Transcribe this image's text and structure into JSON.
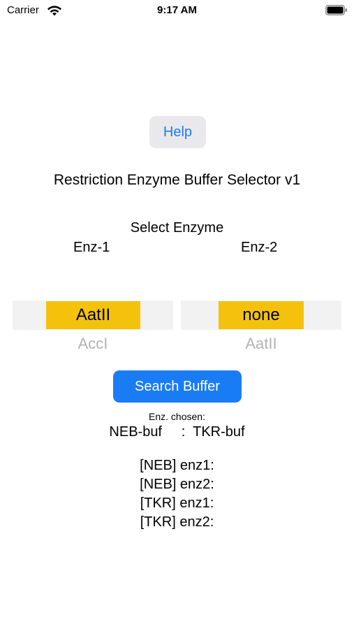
{
  "status_bar": {
    "carrier": "Carrier",
    "time": "9:17 AM",
    "wifi_icon": "wifi-icon",
    "battery_icon": "battery-icon"
  },
  "help": {
    "label": "Help"
  },
  "app_title": "Restriction Enzyme Buffer Selector v1",
  "select_label": "Select Enzyme",
  "enz1": {
    "label": "Enz-1",
    "selected": "AatII",
    "next": "AccI"
  },
  "enz2": {
    "label": "Enz-2",
    "selected": "none",
    "next": "AatII"
  },
  "search": {
    "label": "Search Buffer"
  },
  "enz_chosen_label": "Enz. chosen:",
  "buffers": {
    "neb": "NEB-buf",
    "sep": ":",
    "tkr": "TKR-buf"
  },
  "results": [
    "[NEB] enz1:",
    "[NEB] enz2:",
    "[TKR] enz1:",
    "[TKR] enz2:"
  ],
  "colors": {
    "accent": "#1a7cf5",
    "picker_highlight": "#f4c20d",
    "picker_band": "#f2f2f2",
    "muted_text": "#b3b3b3"
  }
}
